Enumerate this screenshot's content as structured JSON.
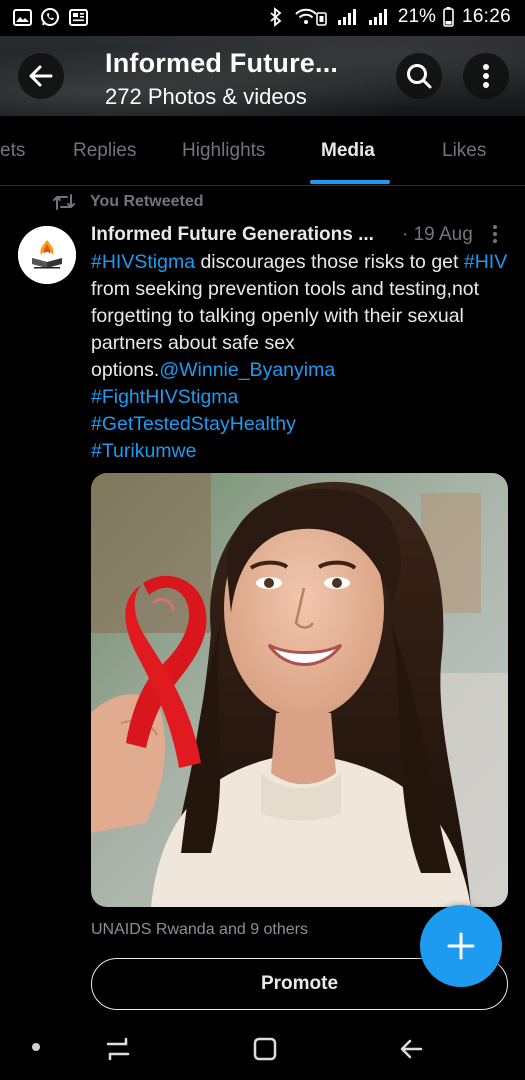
{
  "status_bar": {
    "battery": "21%",
    "time": "16:26",
    "left_icons": [
      "gallery-icon",
      "whatsapp-icon",
      "news-icon"
    ],
    "right_icons": [
      "bluetooth-icon",
      "wifi-icon",
      "signal-icon",
      "signal-icon",
      "battery-icon"
    ]
  },
  "header": {
    "title": "Informed Future...",
    "subtitle": "272 Photos & videos"
  },
  "tabs": [
    {
      "label": "ets"
    },
    {
      "label": "Replies"
    },
    {
      "label": "Highlights"
    },
    {
      "label": "Media",
      "active": true
    },
    {
      "label": "Likes"
    }
  ],
  "tweet": {
    "retweet_label": "You Retweeted",
    "author": "Informed Future Generations ...",
    "date": "· 19 Aug",
    "body": {
      "hashtag1": "#HIVStigma",
      "text1": " discourages those risks to get ",
      "hashtag2": "#HIV",
      "text2": " from seeking prevention tools and testing,not forgetting to talking openly with their sexual partners about safe sex options.",
      "mention": "@Winnie_Byanyima",
      "hashtag3": "#FightHIVStigma",
      "hashtag4": "#GetTestedStayHealthy",
      "hashtag5": "#Turikumwe"
    },
    "likes_line": "UNAIDS Rwanda and 9 others",
    "promote_label": "Promote"
  },
  "colors": {
    "accent": "#1d9bf0",
    "background": "#000000",
    "muted": "#71767b"
  }
}
